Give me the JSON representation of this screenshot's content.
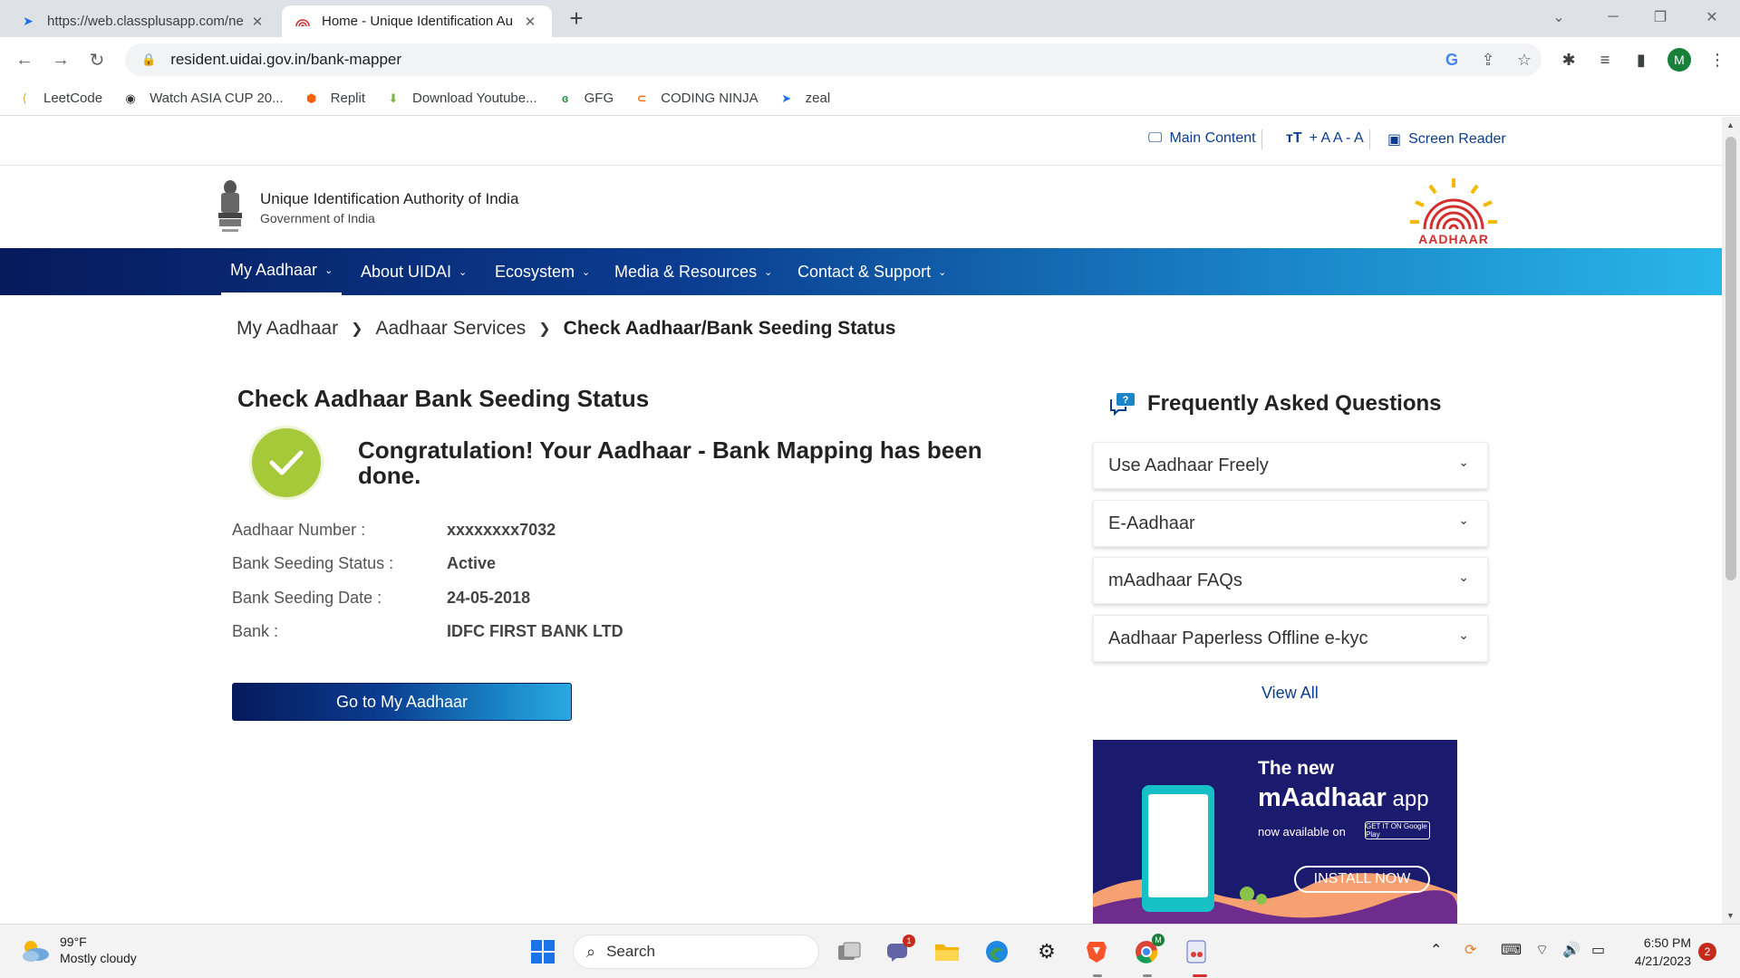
{
  "browser": {
    "tabs": [
      {
        "title": "https://web.classplusapp.com/ne",
        "active": false
      },
      {
        "title": "Home - Unique Identification Au",
        "active": true
      }
    ],
    "url": "resident.uidai.gov.in/bank-mapper",
    "profile_initial": "M",
    "bookmarks": [
      "LeetCode",
      "Watch ASIA CUP 20...",
      "Replit",
      "Download Youtube...",
      "GFG",
      "CODING NINJA",
      "zeal"
    ]
  },
  "accessibility": {
    "main_content": "Main Content",
    "font_size": "+ A A - A",
    "screen_reader": "Screen Reader"
  },
  "header": {
    "org_name": "Unique Identification Authority of India",
    "org_sub": "Government of India",
    "logo_text": "AADHAAR"
  },
  "nav": {
    "items": [
      "My Aadhaar",
      "About UIDAI",
      "Ecosystem",
      "Media & Resources",
      "Contact & Support"
    ]
  },
  "breadcrumb": [
    "My Aadhaar",
    "Aadhaar Services",
    "Check Aadhaar/Bank Seeding Status"
  ],
  "main": {
    "title": "Check Aadhaar Bank Seeding Status",
    "message": "Congratulation! Your Aadhaar - Bank Mapping has been done.",
    "rows": [
      {
        "label": "Aadhaar Number :",
        "value": "xxxxxxxx7032"
      },
      {
        "label": "Bank Seeding Status :",
        "value": "Active"
      },
      {
        "label": "Bank Seeding Date :",
        "value": "24-05-2018"
      },
      {
        "label": "Bank :",
        "value": "IDFC FIRST BANK LTD"
      }
    ],
    "button": "Go to My Aadhaar"
  },
  "faq": {
    "title": "Frequently Asked Questions",
    "items": [
      "Use Aadhaar Freely",
      "E-Aadhaar",
      "mAadhaar FAQs",
      "Aadhaar Paperless Offline e-kyc"
    ],
    "view_all": "View All"
  },
  "banner": {
    "line1": "The new",
    "line2_bold": "mAadhaar",
    "line2_rest": " app",
    "line3": "now available on",
    "store": "GET IT ON Google Play",
    "install": "INSTALL NOW"
  },
  "taskbar": {
    "temp": "99°F",
    "weather": "Mostly cloudy",
    "search": "Search",
    "time": "6:50 PM",
    "date": "4/21/2023",
    "notifications": "2",
    "teams_badge": "1",
    "chrome_badge": "M"
  },
  "colors": {
    "nav_dark": "#061a5c",
    "nav_light": "#29b6e8",
    "link": "#0b3d91",
    "success": "#a6c93a"
  }
}
